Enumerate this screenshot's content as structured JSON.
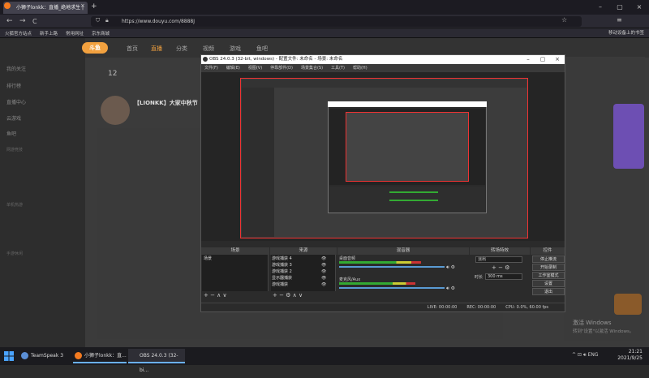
{
  "browser": {
    "tab_title": "小狮子lonkk：直播_绝地求生 |",
    "tab_close": "×",
    "new_tab": "+",
    "url": "https://www.douyu.com/8888J",
    "nav": {
      "back": "←",
      "forward": "→",
      "reload": "C"
    },
    "window": {
      "minimize": "–",
      "maximize": "▢",
      "close": "×"
    },
    "bookmarks": [
      "火狐官方站点",
      "新手上路",
      "常用网址",
      "京东商城"
    ],
    "mobile_bookmark": "移动设备上的书签"
  },
  "douyu": {
    "logo": "斗鱼",
    "topnav": [
      "首页",
      "直播",
      "分类",
      "视频",
      "游戏",
      "鱼吧"
    ],
    "sidebar": [
      "我的关注",
      "排行榜",
      "直播中心",
      "云游戏",
      "鱼吧"
    ],
    "sidebar_groups": [
      "网游竞技",
      "单机热游",
      "手游休闲"
    ],
    "stat_number": "12",
    "streamer_title": "【LIONKK】大家中秋节",
    "activate_title": "激活 Windows",
    "activate_sub": "转到\"设置\"以激活 Windows。"
  },
  "obs": {
    "title": "OBS 24.0.3 (32-bit, windows) - 配置文件: 未命名 - 场景: 未命名",
    "menu": [
      "文件(F)",
      "编辑(E)",
      "视图(V)",
      "停靠部件(D)",
      "场景集合(S)",
      "工具(T)",
      "帮助(H)"
    ],
    "docks": [
      "场景",
      "来源",
      "混音器",
      "转场特效",
      "控件"
    ],
    "scene": "场景",
    "sources": [
      "游戏捕获 4",
      "游戏捕获 3",
      "游戏捕获 2",
      "显示器捕获",
      "游戏捕获"
    ],
    "mixer": [
      {
        "label": "桌面音频",
        "level": 0.78
      },
      {
        "label": "麦克风/Aux",
        "level": 0.72
      }
    ],
    "transition": {
      "name": "淡出",
      "duration_label": "时长",
      "duration": "300 ms"
    },
    "controls": [
      "停止推流",
      "开始录制",
      "工作室模式",
      "设置",
      "退出"
    ],
    "status": [
      "LIVE: 00:00:00",
      "REC: 00:00:00",
      "CPU: 0.0%, 60.00 fps"
    ],
    "window": {
      "minimize": "–",
      "maximize": "▢",
      "close": "×"
    }
  },
  "taskbar": {
    "items": [
      "TeamSpeak 3",
      "小狮子lonkk：直...",
      "OBS 24.0.3 (32-bi..."
    ],
    "language": "ENG",
    "time": "21:21",
    "date": "2021/9/25"
  },
  "colors": {
    "accent": "#f2a13f",
    "obs_accent": "#e33333",
    "meter_green": "#33aa33"
  }
}
